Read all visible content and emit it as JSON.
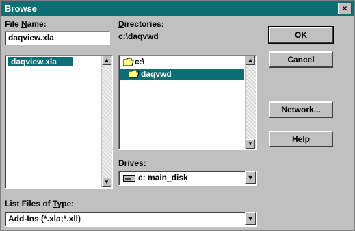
{
  "window": {
    "title": "Browse",
    "close_glyph": "×"
  },
  "file_name": {
    "label_pre": "File ",
    "label_key": "N",
    "label_post": "ame:",
    "value": "daqview.xla",
    "list": [
      "daqview.xla"
    ]
  },
  "directories": {
    "label_key": "D",
    "label_post": "irectories:",
    "path": "c:\\daqvwd",
    "items": [
      {
        "label": "c:\\",
        "icon": "folder-open-icon",
        "selected": false
      },
      {
        "label": "daqvwd",
        "icon": "folder-open-icon",
        "selected": true
      }
    ]
  },
  "drives": {
    "label_pre": "Dri",
    "label_key": "v",
    "label_post": "es:",
    "value": "c: main_disk",
    "icon": "drive-icon"
  },
  "file_type": {
    "label_pre": "List Files of ",
    "label_key": "T",
    "label_post": "ype:",
    "value": "Add-Ins (*.xla;*.xll)"
  },
  "buttons": {
    "ok": "OK",
    "cancel": "Cancel",
    "network": "Network...",
    "help_key": "H",
    "help_post": "elp"
  },
  "colors": {
    "titlebar": "#0d6e73",
    "selection": "#0d6e73",
    "face": "#c0c0c0"
  }
}
